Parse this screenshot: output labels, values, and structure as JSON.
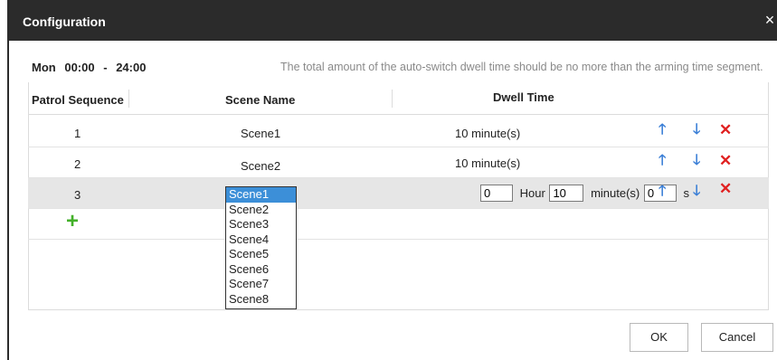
{
  "dialog": {
    "title": "Configuration",
    "close_glyph": "×"
  },
  "schedule": {
    "day": "Mon",
    "start": "00:00",
    "separator": "-",
    "end": "24:00",
    "hint": "The total amount of the auto-switch dwell time should be no more than the arming time segment."
  },
  "table": {
    "headers": {
      "patrol_sequence": "Patrol Sequence",
      "scene_name": "Scene Name",
      "dwell_time": "Dwell Time"
    },
    "rows": [
      {
        "seq": "1",
        "scene": "Scene1",
        "dwell": "10 minute(s)"
      },
      {
        "seq": "2",
        "scene": "Scene2",
        "dwell": "10 minute(s)"
      },
      {
        "seq": "3",
        "scene": "Scene1"
      }
    ],
    "edit_row": {
      "hour_value": "0",
      "hour_label": "Hour",
      "minute_value": "10",
      "minute_label": "minute(s)",
      "second_value": "0",
      "second_label": "s"
    },
    "add_glyph": "+"
  },
  "actions": {
    "up_icon": "arrow-up-icon",
    "down_icon": "arrow-down-icon",
    "delete_icon": "close-icon",
    "up_glyph": "🡑",
    "down_glyph": "🡓",
    "delete_glyph": "✕"
  },
  "scene_dropdown": {
    "selected": "Scene1",
    "options": [
      "Scene1",
      "Scene2",
      "Scene3",
      "Scene4",
      "Scene5",
      "Scene6",
      "Scene7",
      "Scene8"
    ]
  },
  "buttons": {
    "ok": "OK",
    "cancel": "Cancel"
  },
  "colors": {
    "titlebar": "#2b2b2b",
    "arrow": "#3b7fd6",
    "delete": "#e02020",
    "add": "#43b02a",
    "dropdown_highlight": "#3c8fd8"
  }
}
